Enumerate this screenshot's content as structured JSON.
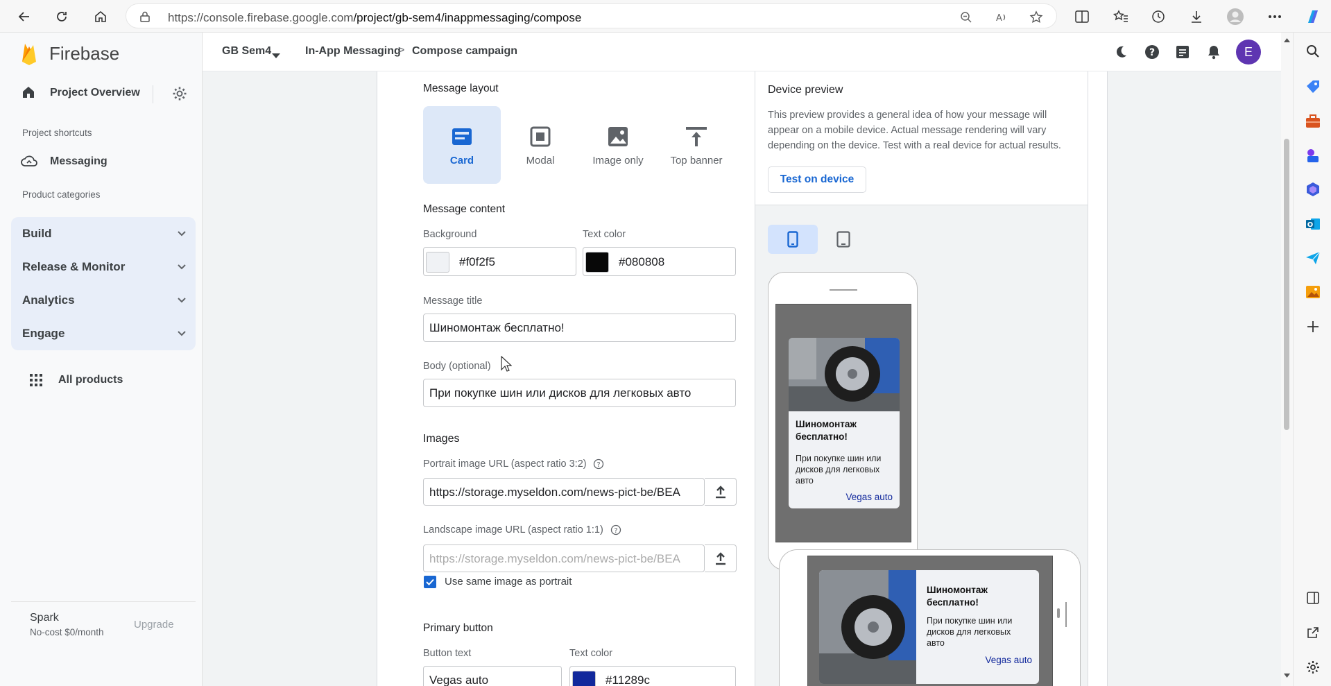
{
  "browser": {
    "url_host": "https://console.firebase.google.com",
    "url_path": "/project/gb-sem4/inappmessaging/compose"
  },
  "sidebar": {
    "brand": "Firebase",
    "project_overview": "Project Overview",
    "shortcuts_label": "Project shortcuts",
    "messaging": "Messaging",
    "categories_label": "Product categories",
    "categories": [
      {
        "label": "Build"
      },
      {
        "label": "Release & Monitor"
      },
      {
        "label": "Analytics"
      },
      {
        "label": "Engage"
      }
    ],
    "all_products": "All products",
    "plan_name": "Spark",
    "plan_sub": "No-cost $0/month",
    "upgrade": "Upgrade"
  },
  "header": {
    "project": "GB Sem4",
    "breadcrumb_1": "In-App Messaging",
    "breadcrumb_sep": ">",
    "breadcrumb_2": "Compose campaign",
    "avatar_letter": "E"
  },
  "form": {
    "layout_label": "Message layout",
    "layouts": [
      {
        "label": "Card",
        "selected": true
      },
      {
        "label": "Modal",
        "selected": false
      },
      {
        "label": "Image only",
        "selected": false
      },
      {
        "label": "Top banner",
        "selected": false
      }
    ],
    "content_label": "Message content",
    "background_label": "Background",
    "background_value": "#f0f2f5",
    "text_color_label": "Text color",
    "text_color_value": "#080808",
    "title_label": "Message title",
    "title_value": "Шиномонтаж бесплатно!",
    "body_label": "Body (optional)",
    "body_value": "При покупке шин или дисков для легковых авто",
    "images_label": "Images",
    "portrait_label": "Portrait image URL (aspect ratio 3:2)",
    "portrait_value": "https://storage.myseldon.com/news-pict-be/BEA",
    "landscape_label": "Landscape image URL (aspect ratio 1:1)",
    "landscape_placeholder": "https://storage.myseldon.com/news-pict-be/BEA",
    "same_image_label": "Use same image as portrait",
    "primary_button_label": "Primary button",
    "button_text_label": "Button text",
    "button_text_value": "Vegas auto",
    "button_color_label": "Text color",
    "button_color_value": "#11289c"
  },
  "preview": {
    "title": "Device preview",
    "description": "This preview provides a general idea of how your message will appear on a mobile device. Actual message rendering will vary depending on the device. Test with a real device for actual results.",
    "test_button": "Test on device",
    "card_title": "Шиномонтаж бесплатно!",
    "card_body": "При покупке шин или дисков для легковых авто",
    "card_button": "Vegas auto"
  },
  "colors": {
    "accent": "#1967d2",
    "button_text": "#11289c"
  }
}
